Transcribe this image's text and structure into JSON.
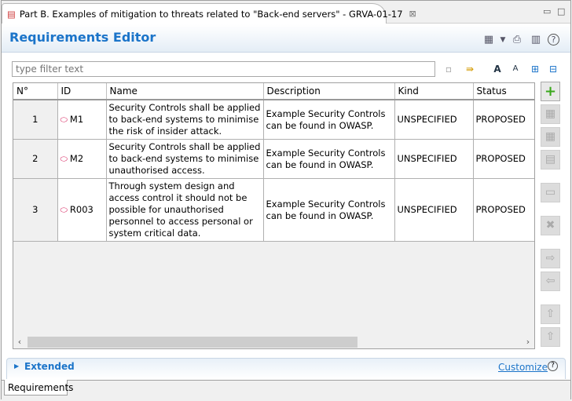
{
  "editor_tab": {
    "title": "Part B. Examples of mitigation to threats related to \"Back-end servers\" - GRVA-01-17",
    "close": "⊠"
  },
  "header": {
    "title": "Requirements Editor"
  },
  "filter": {
    "placeholder": "type filter text",
    "value": ""
  },
  "table": {
    "columns": [
      "N°",
      "ID",
      "Name",
      "Description",
      "Kind",
      "Status"
    ],
    "rows": [
      {
        "num": "1",
        "id": "M1",
        "name": "Security Controls shall be applied to back-end systems to minimise the risk of insider attack.",
        "description": "Example Security Controls can be found in OWASP.",
        "kind": "UNSPECIFIED",
        "status": "PROPOSED"
      },
      {
        "num": "2",
        "id": "M2",
        "name": "Security Controls shall be applied to back-end systems to minimise unauthorised access.",
        "description": "Example Security Controls can be found in OWASP.",
        "kind": "UNSPECIFIED",
        "status": "PROPOSED"
      },
      {
        "num": "3",
        "id": "R003",
        "name": "Through system design and access control it should not be possible for unauthorised personnel to access personal or system critical data.",
        "description": "Example Security Controls can be found in OWASP.",
        "kind": "UNSPECIFIED",
        "status": "PROPOSED"
      }
    ]
  },
  "extended": {
    "label": "Extended",
    "customize": "Customize"
  },
  "bottom_tab": {
    "label": "Requirements"
  },
  "colors": {
    "accent": "#1b74c9",
    "id_icon": "#d6205c"
  }
}
